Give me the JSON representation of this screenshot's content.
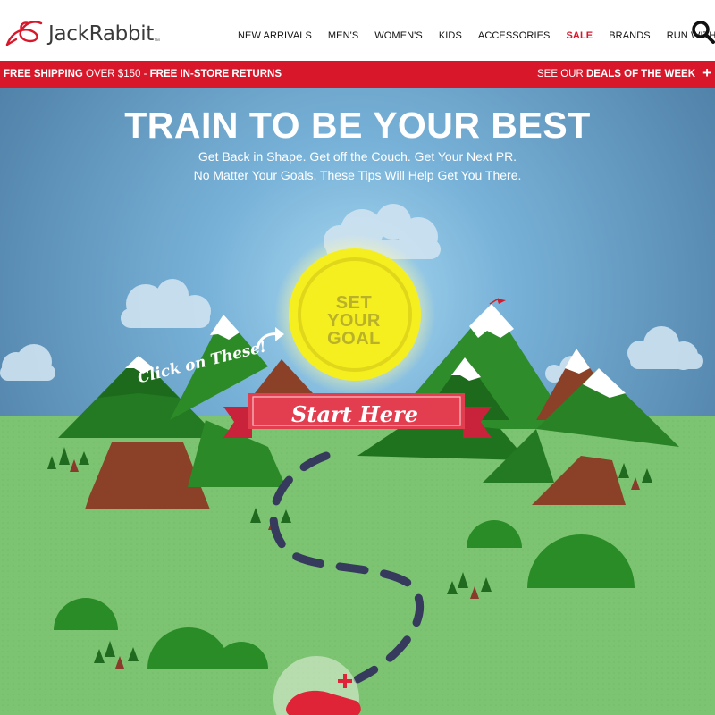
{
  "header": {
    "brand": "JackRabbit",
    "brand_tm": "™",
    "nav": [
      "NEW ARRIVALS",
      "MEN'S",
      "WOMEN'S",
      "KIDS",
      "ACCESSORIES",
      "SALE",
      "BRANDS",
      "RUN WITH US"
    ],
    "sale_color": "#d9172b",
    "search_icon": "search-icon"
  },
  "promo": {
    "shipping_bold": "FREE SHIPPING",
    "shipping_rest": " OVER $150 - ",
    "returns_bold": "FREE IN-STORE RETURNS",
    "deals_prefix": "SEE OUR ",
    "deals_bold": "DEALS OF THE WEEK",
    "plus": "+",
    "bar_color": "#d9172b"
  },
  "hero": {
    "title": "TRAIN TO BE YOUR BEST",
    "subtitle_line1": "Get Back in Shape. Get off the Couch. Get Your Next PR.",
    "subtitle_line2": "No Matter Your Goals, These Tips Will Help Get You There.",
    "goal_line1": "SET",
    "goal_line2": "YOUR",
    "goal_line3": "GOAL",
    "start_label": "Start Here",
    "click_label": "Click on These!",
    "sky_color": "#5a8ab0",
    "grass_color": "#7cc472"
  }
}
